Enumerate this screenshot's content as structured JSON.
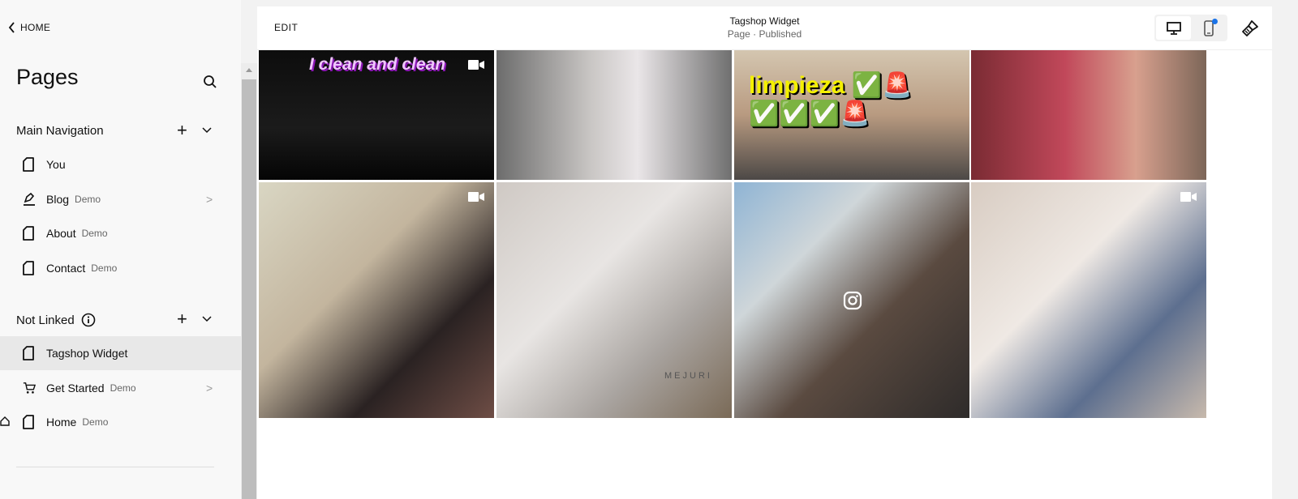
{
  "sidebar": {
    "back_label": "HOME",
    "title": "Pages",
    "sections": [
      {
        "label": "Main Navigation",
        "items": [
          {
            "label": "You",
            "badge": "",
            "icon": "page-icon"
          },
          {
            "label": "Blog",
            "badge": "Demo",
            "icon": "blog-pen-icon",
            "chevron": true
          },
          {
            "label": "About",
            "badge": "Demo",
            "icon": "page-icon"
          },
          {
            "label": "Contact",
            "badge": "Demo",
            "icon": "page-icon"
          }
        ]
      },
      {
        "label": "Not Linked",
        "items": [
          {
            "label": "Tagshop Widget",
            "badge": "",
            "icon": "page-icon",
            "selected": true
          },
          {
            "label": "Get Started",
            "badge": "Demo",
            "icon": "cart-icon",
            "chevron": true
          },
          {
            "label": "Home",
            "badge": "Demo",
            "icon": "page-icon",
            "homepage": true
          }
        ]
      }
    ]
  },
  "header": {
    "edit_label": "EDIT",
    "page_title": "Tagshop Widget",
    "page_status": "Page · Published",
    "active_device": "desktop",
    "accent": "#1a73e8"
  },
  "gallery": {
    "tiles": [
      {
        "overlay": "I clean and clean",
        "type": "video"
      },
      {
        "overlay": "",
        "type": "image"
      },
      {
        "overlay": "limpieza ✅🚨 ✅✅✅🚨",
        "type": "image"
      },
      {
        "overlay": "",
        "type": "image"
      },
      {
        "overlay": "",
        "type": "video"
      },
      {
        "overlay": "MEJURI",
        "type": "image"
      },
      {
        "overlay": "",
        "type": "instagram"
      },
      {
        "overlay": "",
        "type": "video"
      }
    ]
  }
}
